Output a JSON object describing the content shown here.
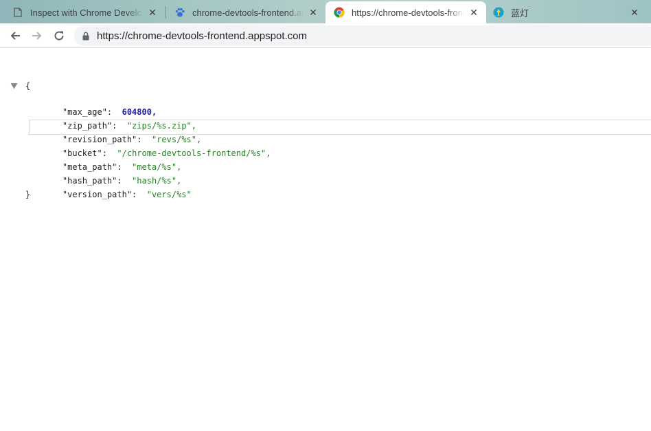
{
  "tabs": [
    {
      "title": "Inspect with Chrome Developer Tools",
      "favicon": "page-icon",
      "active": false
    },
    {
      "title": "chrome-devtools-frontend.appspot.com",
      "favicon": "paw-icon",
      "active": false
    },
    {
      "title": "https://chrome-devtools-frontend.appspot.com",
      "favicon": "chrome-icon",
      "active": true
    },
    {
      "title": "蓝灯",
      "favicon": "lantern-icon",
      "active": false
    }
  ],
  "toolbar": {
    "back_icon": "back-arrow-icon",
    "forward_icon": "forward-arrow-icon",
    "reload_icon": "reload-icon",
    "url": "https://chrome-devtools-frontend.appspot.com"
  },
  "json": {
    "open_brace": "{",
    "close_brace": "}",
    "entries": [
      {
        "key": "\"max_age\":",
        "value": "604800,",
        "type": "number"
      },
      {
        "key": "\"zip_path\":",
        "value": "\"zips/%s.zip\",",
        "type": "string"
      },
      {
        "key": "\"revision_path\":",
        "value": "\"revs/%s\",",
        "type": "string"
      },
      {
        "key": "\"bucket\":",
        "value": "\"/chrome-devtools-frontend/%s\",",
        "type": "string"
      },
      {
        "key": "\"meta_path\":",
        "value": "\"meta/%s\",",
        "type": "string"
      },
      {
        "key": "\"hash_path\":",
        "value": "\"hash/%s\",",
        "type": "string"
      },
      {
        "key": "\"version_path\":",
        "value": "\"vers/%s\"",
        "type": "string"
      }
    ]
  },
  "colors": {
    "number": "#1a1aa6",
    "string": "#2a7f2a",
    "omnibox_bg": "#f1f3f4"
  }
}
